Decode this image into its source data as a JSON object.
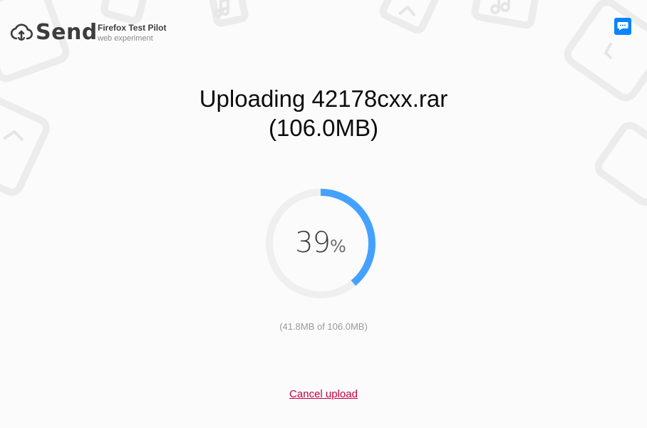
{
  "header": {
    "app_name": "Send",
    "test_pilot_title": "Firefox Test Pilot",
    "test_pilot_subtitle": "web experiment"
  },
  "upload": {
    "title_line1": "Uploading 42178cxx.rar",
    "title_line2": "(106.0MB)",
    "percent_value": "39",
    "percent_sign": "%",
    "progress_fraction": 0.39,
    "size_progress": "(41.8MB of 106.0MB)",
    "cancel_label": "Cancel upload"
  },
  "colors": {
    "accent": "#0a84ff",
    "progress_arc": "#45a1ff",
    "progress_track": "#efefef",
    "cancel_link": "#c50042"
  },
  "icons": {
    "logo": "send-cloud-icon",
    "feedback": "chat-bubble-icon"
  }
}
